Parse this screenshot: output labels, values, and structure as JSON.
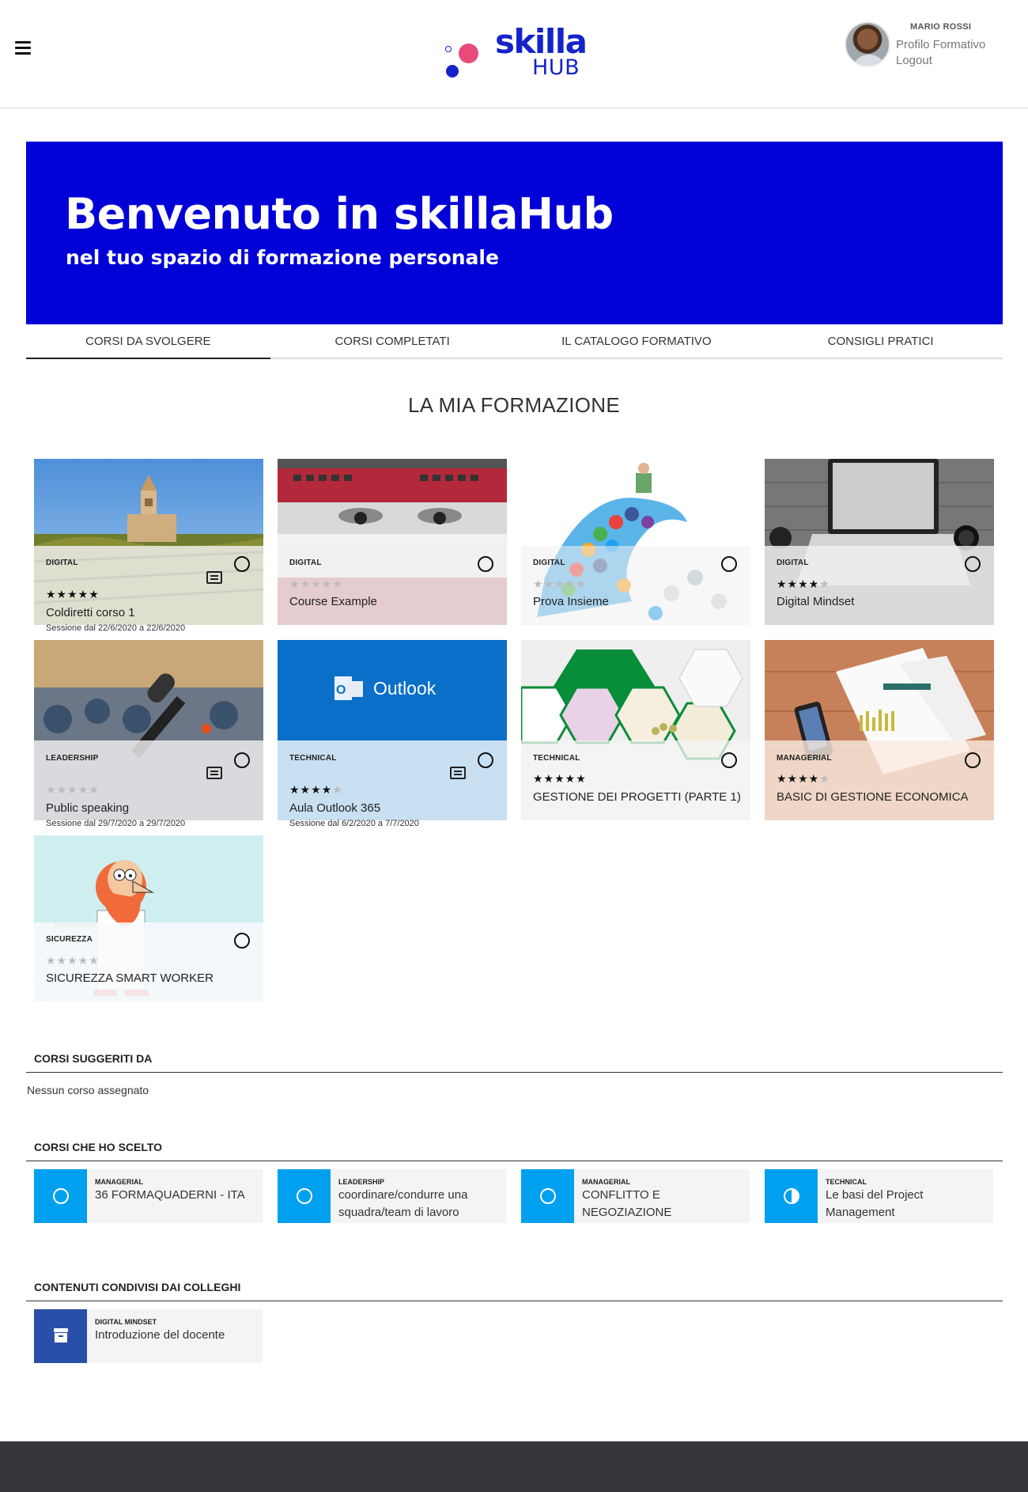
{
  "header": {
    "logo_main": "skilla",
    "logo_sub": "HUB",
    "user_name": "MARIO ROSSI",
    "profile_link": "Profilo Formativo",
    "logout_link": "Logout"
  },
  "hero": {
    "title": "Benvenuto in skillaHub",
    "subtitle": "nel tuo spazio di formazione personale"
  },
  "tabs": [
    "CORSI DA SVOLGERE",
    "CORSI COMPLETATI",
    "IL CATALOGO FORMATIVO",
    "CONSIGLI PRATICI"
  ],
  "section_title": "LA MIA FORMAZIONE",
  "courses": [
    {
      "category": "DIGITAL",
      "stars": 5,
      "title": "Coldiretti corso 1",
      "session": "Sessione dal 22/6/2020 a 22/6/2020",
      "image": "vineyard-church"
    },
    {
      "category": "DIGITAL",
      "stars": 0,
      "title": "Course Example",
      "session": "",
      "image": "espresso-machine"
    },
    {
      "category": "DIGITAL",
      "stars": 0,
      "title": "Prova Insieme",
      "session": "",
      "image": "social-wave"
    },
    {
      "category": "DIGITAL",
      "stars": 4,
      "title": "Digital Mindset",
      "session": "",
      "image": "laptop-desk"
    },
    {
      "category": "LEADERSHIP",
      "stars": 0,
      "title": "Public speaking",
      "session": "Sessione dal 29/7/2020 a 29/7/2020",
      "image": "microphone"
    },
    {
      "category": "TECHNICAL",
      "stars": 4,
      "title": "Aula Outlook 365",
      "session": "Sessione dal 6/2/2020 a 7/7/2020",
      "image": "outlook",
      "image_label": "Outlook"
    },
    {
      "category": "TECHNICAL",
      "stars": 5,
      "title": "GESTIONE DEI PROGETTI (PARTE 1)",
      "session": "",
      "image": "hexagons"
    },
    {
      "category": "MANAGERIAL",
      "stars": 4,
      "title": "BASIC DI GESTIONE ECONOMICA",
      "session": "",
      "image": "charts-desk"
    },
    {
      "category": "SICUREZZA",
      "stars": 0,
      "title": "SICUREZZA SMART WORKER",
      "session": "",
      "image": "cartoon-worker"
    }
  ],
  "suggested": {
    "title": "CORSI SUGGERITI DA",
    "empty_text": "Nessun corso assegnato"
  },
  "chosen": {
    "title": "CORSI CHE HO SCELTO",
    "items": [
      {
        "category": "MANAGERIAL",
        "title": "36 FORMAQUADERNI - ITA",
        "status": "circle-icon"
      },
      {
        "category": "LEADERSHIP",
        "title": "coordinare/condurre una squadra/team di lavoro",
        "status": "circle-icon"
      },
      {
        "category": "MANAGERIAL",
        "title": "CONFLITTO E NEGOZIAZIONE",
        "status": "circle-icon"
      },
      {
        "category": "TECHNICAL",
        "title": "Le basi del Project Management",
        "status": "half-circle-icon"
      }
    ]
  },
  "shared": {
    "title": "CONTENUTI CONDIVISI DAI COLLEGHI",
    "items": [
      {
        "category": "DIGITAL MINDSET",
        "title": "Introduzione del docente",
        "status": "archive-icon"
      }
    ]
  },
  "colors": {
    "brand_blue": "#0000d7",
    "logo_pink": "#e94a7a",
    "accent_cyan": "#00a0f0",
    "footer": "#34363a"
  }
}
